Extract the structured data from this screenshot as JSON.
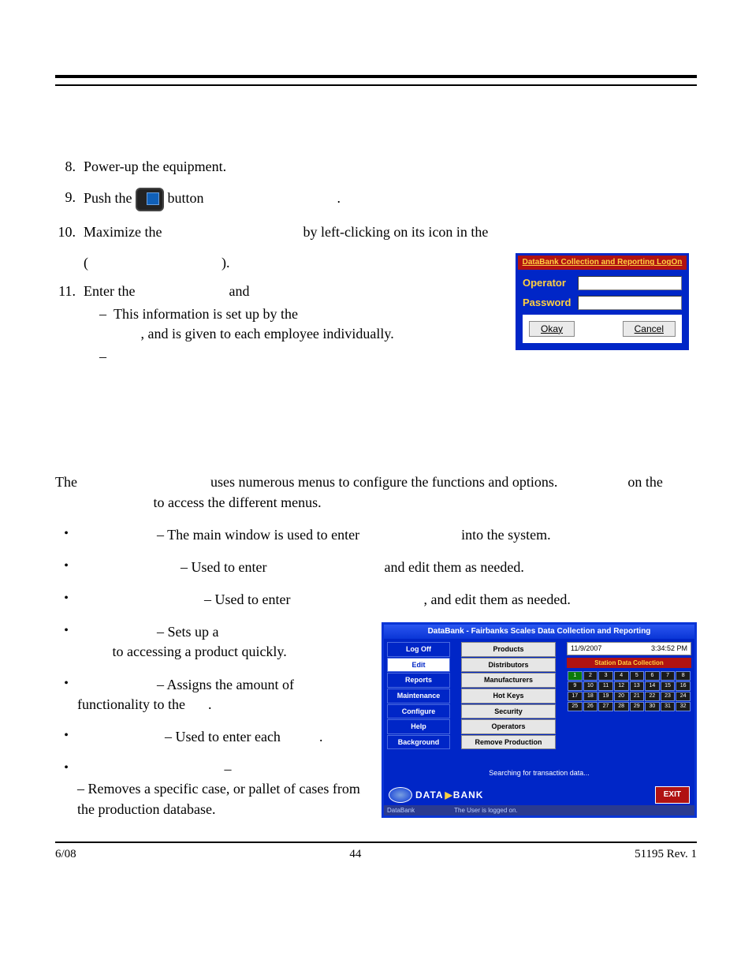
{
  "header": {},
  "steps": {
    "s8": {
      "num": "8.",
      "text": "Power-up the equipment."
    },
    "s9": {
      "num": "9.",
      "t1": "Push the",
      "t2": "button",
      "t3": "."
    },
    "s10": {
      "num": "10.",
      "t1": "Maximize the",
      "t2": "by left-clicking on its icon in the",
      "t3": "(",
      "t4": ")."
    },
    "s11": {
      "num": "11.",
      "t1": "Enter the",
      "t2": "and",
      "dash1a": "This information is set up by the",
      "dash1b": ", and is given to each employee individually."
    }
  },
  "login": {
    "title": "DataBank Collection and Reporting LogOn",
    "operator": "Operator",
    "password": "Password",
    "okay": "Okay",
    "cancel": "Cancel"
  },
  "midpara": {
    "t1": "The",
    "t2": "uses numerous menus to configure the functions and options.",
    "t3": "on the",
    "t4": "to access the different menus."
  },
  "bullets": {
    "b1": {
      "t1": "– The main window is used to enter",
      "t2": "into the system."
    },
    "b2": {
      "t1": "–  Used to enter",
      "t2": "and edit them as needed."
    },
    "b3": {
      "t1": "–  Used to enter",
      "t2": ", and edit them as needed."
    },
    "b4": {
      "t1": "– Sets up a",
      "t2": "to accessing a product quickly."
    },
    "b5": {
      "t1": "– Assigns the amount of functionality to the",
      "t2": "."
    },
    "b6": {
      "t1": "– Used to enter each",
      "t2": "."
    },
    "b7": {
      "t1": "– Removes a specific case, or pallet of cases from the production database."
    }
  },
  "db": {
    "title": "DataBank - Fairbanks Scales Data Collection and Reporting",
    "side": [
      "Log Off",
      "Edit",
      "Reports",
      "Maintenance",
      "Configure",
      "Help",
      "Background"
    ],
    "center": [
      "Products",
      "Distributors",
      "Manufacturers",
      "Hot Keys",
      "Security",
      "Operators",
      "Remove Production"
    ],
    "date": "11/9/2007",
    "time": "3:34:52 PM",
    "station": "Station Data Collection",
    "grid_r1": [
      "1",
      "2",
      "3",
      "4",
      "5",
      "6",
      "7",
      "8"
    ],
    "grid_r2": [
      "9",
      "10",
      "11",
      "12",
      "13",
      "14",
      "15",
      "16"
    ],
    "grid_r3": [
      "17",
      "18",
      "19",
      "20",
      "21",
      "22",
      "23",
      "24"
    ],
    "grid_r4": [
      "25",
      "26",
      "27",
      "28",
      "29",
      "30",
      "31",
      "32"
    ],
    "searching": "Searching for transaction data...",
    "logo1": "DATA",
    "logo2": "BANK",
    "exit": "EXIT",
    "status1": "DataBank",
    "status2": "The User is logged on."
  },
  "footer": {
    "left": "6/08",
    "center": "44",
    "right": "51195    Rev. 1"
  }
}
